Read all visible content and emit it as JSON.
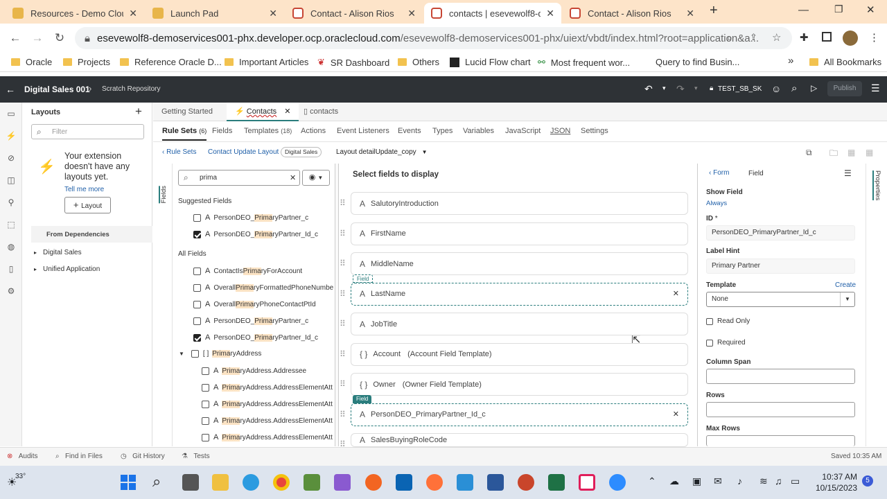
{
  "browser": {
    "tabs": [
      {
        "title": "Resources - Demo Cloud",
        "fav": "yellow"
      },
      {
        "title": "Launch Pad",
        "fav": "yellow"
      },
      {
        "title": "Contact - Alison Rios",
        "fav": "red"
      },
      {
        "title": "contacts | esevewolf8-de",
        "fav": "red"
      },
      {
        "title": "Contact - Alison Rios",
        "fav": "red"
      }
    ],
    "new_tab": "+",
    "url_host": "esevewolf8-demoservices001-phx.developer.ocp.oraclecloud.com",
    "url_rest": "/esevewolf8-demoservices001-phx/uiext/vbdt/index.html?root=application&a...",
    "bookmarks": [
      {
        "label": "Oracle",
        "icon": "folder-icon"
      },
      {
        "label": "Projects",
        "icon": "folder-icon"
      },
      {
        "label": "Reference Oracle D...",
        "icon": "folder-icon"
      },
      {
        "label": "Important Articles",
        "icon": "folder-icon"
      },
      {
        "label": "SR Dashboard",
        "icon": "page-icon"
      },
      {
        "label": "Others",
        "icon": "folder-icon"
      },
      {
        "label": "Lucid Flow chart",
        "icon": "lucid-icon"
      },
      {
        "label": "Most frequent wor...",
        "icon": "link-icon"
      },
      {
        "label": "Query to find Busin...",
        "icon": "none"
      }
    ],
    "bookmarks_overflow": "»",
    "all_bookmarks": "All Bookmarks"
  },
  "header": {
    "app_title": "Digital Sales 001",
    "repo": "Scratch Repository",
    "workspace": "TEST_SB_SK",
    "publish": "Publish"
  },
  "layouts": {
    "title": "Layouts",
    "filter_placeholder": "Filter",
    "empty_msg": "Your extension doesn't have any layouts yet.",
    "tell_more": "Tell me more",
    "add_layout": "Layout",
    "from_deps": "From Dependencies",
    "deps": [
      "Digital Sales",
      "Unified Application"
    ]
  },
  "editor": {
    "tabs": [
      "Getting Started",
      "Contacts",
      "contacts"
    ],
    "subtabs": [
      {
        "label": "Rule Sets",
        "count": "(6)"
      },
      {
        "label": "Fields",
        "count": ""
      },
      {
        "label": "Templates",
        "count": "(18)"
      },
      {
        "label": "Actions",
        "count": ""
      },
      {
        "label": "Event Listeners",
        "count": ""
      },
      {
        "label": "Events",
        "count": ""
      },
      {
        "label": "Types",
        "count": ""
      },
      {
        "label": "Variables",
        "count": ""
      },
      {
        "label": "JavaScript",
        "count": ""
      },
      {
        "label": "JSON",
        "count": ""
      },
      {
        "label": "Settings",
        "count": ""
      }
    ],
    "breadcrumb_back": "Rule Sets",
    "breadcrumb_layout": "Contact Update Layout",
    "breadcrumb_badge": "Digital Sales",
    "layout_select": "Layout detailUpdate_copy",
    "fields_vertical": "Fields",
    "search_value": "prima",
    "suggested_header": "Suggested Fields",
    "suggested": [
      {
        "pre": "PersonDEO_",
        "hl": "Prima",
        "post": "ryPartner_c",
        "checked": false
      },
      {
        "pre": "PersonDEO_",
        "hl": "Prima",
        "post": "ryPartner_Id_c",
        "checked": true
      }
    ],
    "all_header": "All Fields",
    "all_fields": [
      {
        "pre": "ContactIs",
        "hl": "Prima",
        "post": "ryForAccount",
        "checked": false
      },
      {
        "pre": "Overall",
        "hl": "Prima",
        "post": "ryFormattedPhoneNumbe",
        "checked": false
      },
      {
        "pre": "Overall",
        "hl": "Prima",
        "post": "ryPhoneContactPtId",
        "checked": false
      },
      {
        "pre": "PersonDEO_",
        "hl": "Prima",
        "post": "ryPartner_c",
        "checked": false
      },
      {
        "pre": "PersonDEO_",
        "hl": "Prima",
        "post": "ryPartner_Id_c",
        "checked": true
      }
    ],
    "address_group": {
      "pre": "",
      "hl": "Prima",
      "post": "ryAddress"
    },
    "address_children": [
      {
        "hl": "Prima",
        "post": "ryAddress.Addressee"
      },
      {
        "hl": "Prima",
        "post": "ryAddress.AddressElementAtt"
      },
      {
        "hl": "Prima",
        "post": "ryAddress.AddressElementAtt"
      },
      {
        "hl": "Prima",
        "post": "ryAddress.AddressElementAtt"
      },
      {
        "hl": "Prima",
        "post": "ryAddress.AddressElementAtt"
      }
    ],
    "canvas_title": "Select fields to display",
    "canvas_fields": [
      {
        "label": "SalutoryIntroduction",
        "icon": "A",
        "extra": ""
      },
      {
        "label": "FirstName",
        "icon": "A",
        "extra": ""
      },
      {
        "label": "MiddleName",
        "icon": "A",
        "extra": ""
      },
      {
        "label": "LastName",
        "icon": "A",
        "extra": "",
        "tag": "Field",
        "dashed": true
      },
      {
        "label": "JobTitle",
        "icon": "A",
        "extra": ""
      },
      {
        "label": "Account",
        "icon": "{ }",
        "extra": "(Account Field Template)"
      },
      {
        "label": "Owner",
        "icon": "{ }",
        "extra": "(Owner Field Template)"
      },
      {
        "label": "PersonDEO_PrimaryPartner_Id_c",
        "icon": "A",
        "extra": "",
        "tag": "Field",
        "dashed": true
      },
      {
        "label": "SalesBuyingRoleCode",
        "icon": "A",
        "extra": ""
      }
    ]
  },
  "properties": {
    "back": "Form",
    "title": "Field",
    "vertical": "Properties",
    "show_field_label": "Show Field",
    "show_field_value": "Always",
    "id_label": "ID",
    "id_req": "*",
    "id_value": "PersonDEO_PrimaryPartner_Id_c",
    "label_hint_label": "Label Hint",
    "label_hint_value": "Primary Partner",
    "template_label": "Template",
    "template_create": "Create",
    "template_value": "None",
    "read_only": "Read Only",
    "required": "Required",
    "column_span": "Column Span",
    "rows": "Rows",
    "max_rows": "Max Rows"
  },
  "status": {
    "items": [
      "Audits",
      "Find in Files",
      "Git History",
      "Tests"
    ],
    "saved": "Saved 10:35 AM"
  },
  "taskbar": {
    "temp": "33°",
    "time": "10:37 AM",
    "date": "10/15/2023",
    "badge": "5"
  },
  "colors": {
    "accent": "#2a7d7d",
    "header_bg": "#2e3236",
    "tab_strip": "#fde4c9",
    "highlight": "#fbe3c4"
  }
}
